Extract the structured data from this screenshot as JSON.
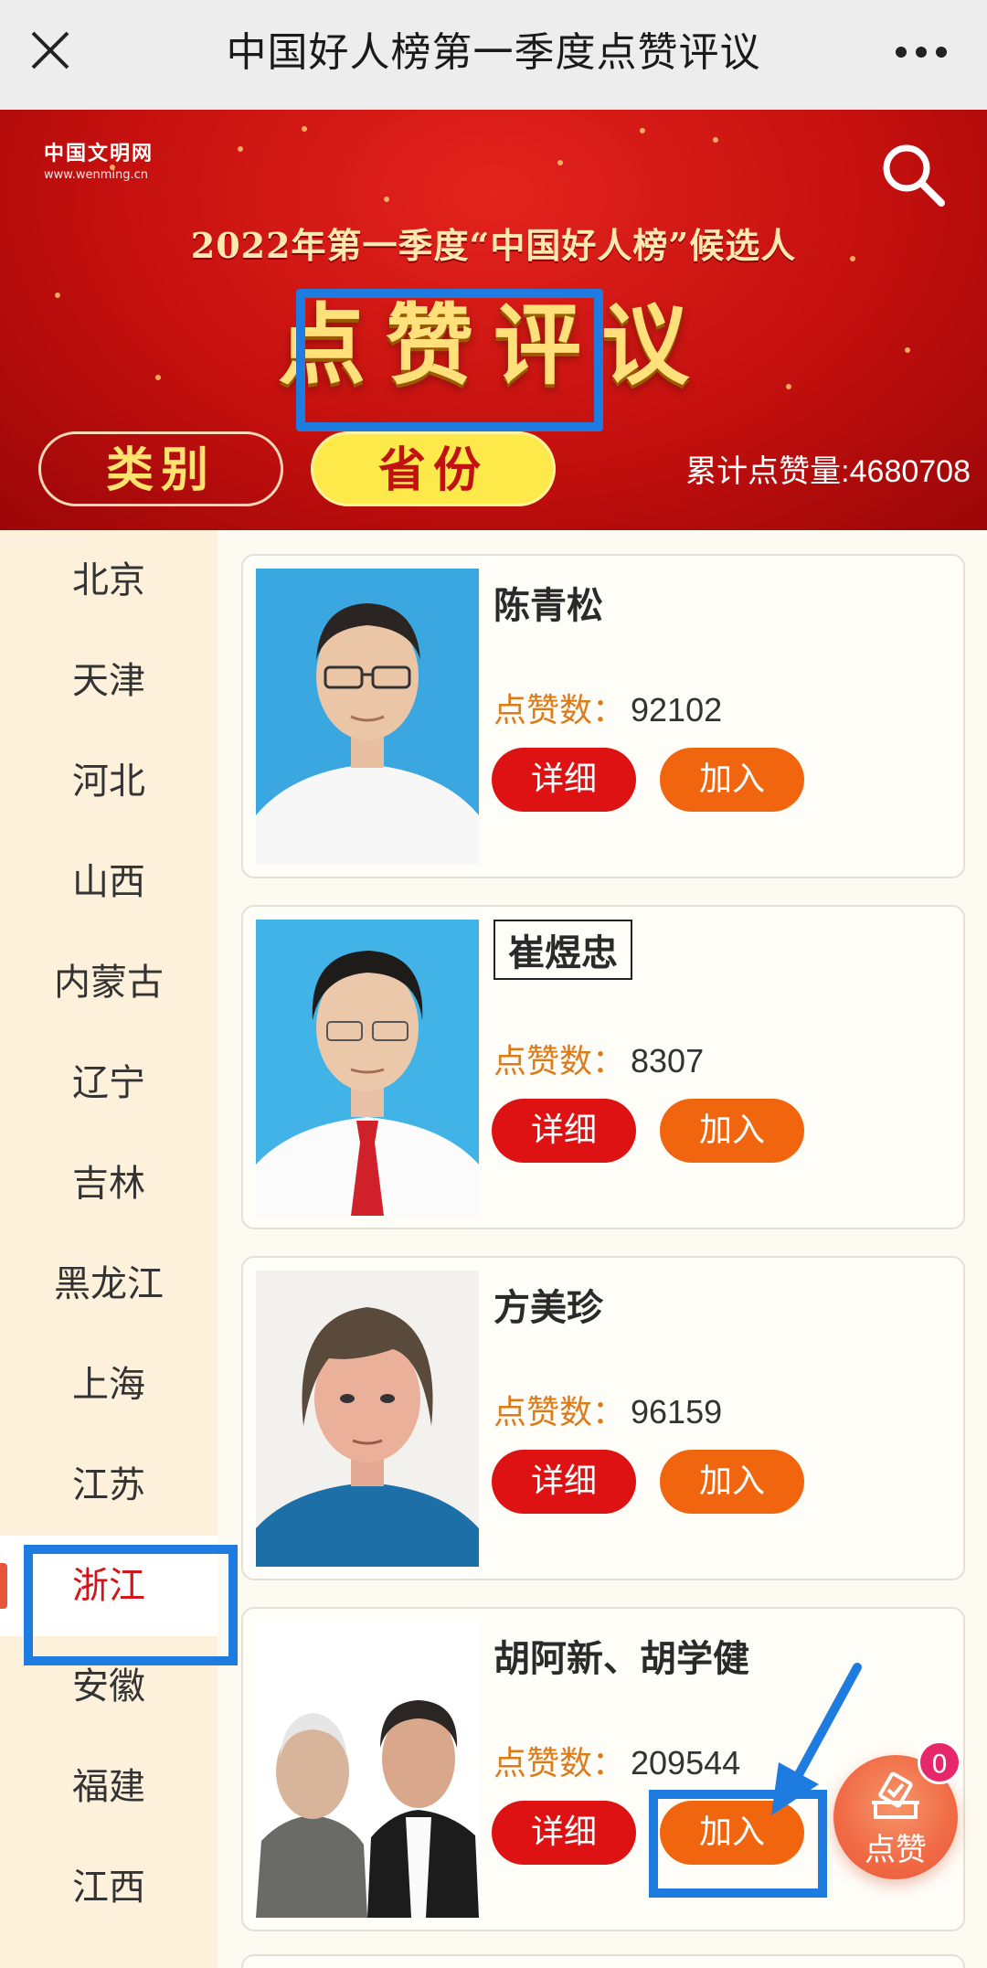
{
  "topbar": {
    "title": "中国好人榜第一季度点赞评议"
  },
  "banner": {
    "brand": "中国文明网",
    "brand_url": "www.wenming.cn",
    "subtitle": "2022年第一季度“中国好人榜”候选人",
    "title": "点赞评议",
    "tab_category": "类别",
    "tab_province": "省份",
    "total_label": "累计点赞量:",
    "total_value": "4680708"
  },
  "sidebar": {
    "provinces": [
      "北京",
      "天津",
      "河北",
      "山西",
      "内蒙古",
      "辽宁",
      "吉林",
      "黑龙江",
      "上海",
      "江苏",
      "浙江",
      "安徽",
      "福建",
      "江西"
    ],
    "active": "浙江"
  },
  "candidates": [
    {
      "name": "陈青松",
      "votes_label": "点赞数：",
      "votes": "92102",
      "detail_label": "详细",
      "join_label": "加入"
    },
    {
      "name": "崔煜忠",
      "votes_label": "点赞数：",
      "votes": "8307",
      "detail_label": "详细",
      "join_label": "加入"
    },
    {
      "name": "方美珍",
      "votes_label": "点赞数：",
      "votes": "96159",
      "detail_label": "详细",
      "join_label": "加入"
    },
    {
      "name": "胡阿新、胡学健",
      "votes_label": "点赞数：",
      "votes": "209544",
      "detail_label": "详细",
      "join_label": "加入"
    }
  ],
  "fab": {
    "label": "点赞",
    "badge": "0"
  },
  "colors": {
    "accent_red": "#c4100e",
    "highlight_blue": "#1e7be0",
    "join_orange": "#f2650f",
    "detail_red": "#de1212"
  }
}
